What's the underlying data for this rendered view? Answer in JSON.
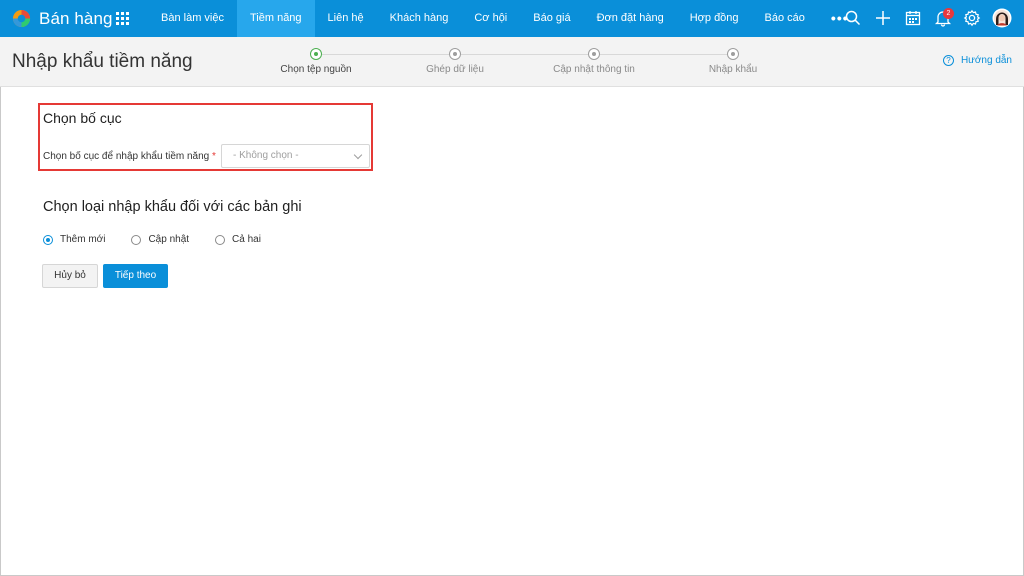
{
  "app": {
    "title": "Bán hàng"
  },
  "nav": {
    "items": [
      {
        "label": "Bàn làm việc"
      },
      {
        "label": "Tiềm năng",
        "active": true
      },
      {
        "label": "Liên hệ"
      },
      {
        "label": "Khách hàng"
      },
      {
        "label": "Cơ hội"
      },
      {
        "label": "Báo giá"
      },
      {
        "label": "Đơn đặt hàng"
      },
      {
        "label": "Hợp đồng"
      },
      {
        "label": "Báo cáo"
      }
    ],
    "more_label": "•••"
  },
  "topbar": {
    "icons": [
      "search-icon",
      "plus-icon",
      "calendar-icon",
      "bell-icon",
      "gear-icon",
      "avatar"
    ],
    "notification_count": "2"
  },
  "colors": {
    "brand": "#0a8fd9",
    "active_tab": "#27a7ec",
    "step_active": "#4caf50",
    "highlight": "#e53935"
  },
  "header": {
    "title": "Nhập khẩu tiềm năng",
    "help_label": "Hướng dẫn",
    "steps": [
      {
        "label": "Chọn tệp nguồn",
        "active": true
      },
      {
        "label": "Ghép dữ liệu"
      },
      {
        "label": "Cập nhật thông tin"
      },
      {
        "label": "Nhập khẩu"
      }
    ]
  },
  "layout_section": {
    "title": "Chọn bố cục",
    "field_label": "Chọn bố cục để nhập khẩu tiềm năng",
    "required_mark": "*",
    "select_value": "- Không chọn -"
  },
  "import_type": {
    "title": "Chọn loại nhập khẩu đối với các bản ghi",
    "options": [
      {
        "label": "Thêm mới",
        "checked": true
      },
      {
        "label": "Cập nhật"
      },
      {
        "label": "Cả hai"
      }
    ]
  },
  "actions": {
    "cancel_label": "Hủy bỏ",
    "next_label": "Tiếp theo"
  }
}
